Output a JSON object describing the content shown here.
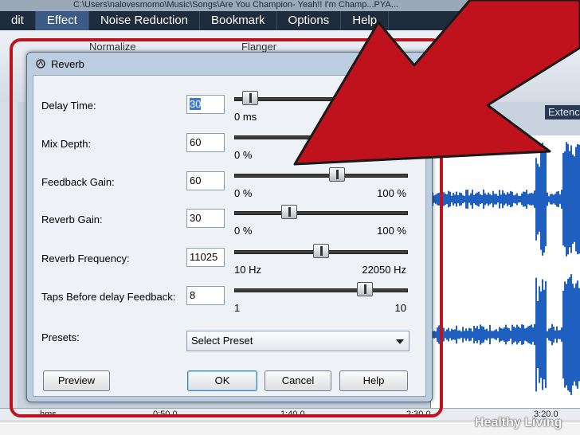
{
  "window": {
    "title": "C:\\Users\\nalovesmomo\\Music\\Songs\\Are You Champion- Yeah!! I'm Champ...PYA..."
  },
  "menubar": {
    "items": [
      "dit",
      "Effect",
      "Noise Reduction",
      "Bookmark",
      "Options",
      "Help"
    ],
    "active": "Effect"
  },
  "toolbar": {
    "normalize_label": "Normalize",
    "flanger_label": "Flanger",
    "extend_tab_label": "Extenc"
  },
  "dialog": {
    "title": "Reverb",
    "params": [
      {
        "label": "Delay Time:",
        "value": "30",
        "min_label": "0 ms",
        "max_label": "",
        "level": 0.05
      },
      {
        "label": "Mix Depth:",
        "value": "60",
        "min_label": "0 %",
        "max_label": "",
        "level": 0.6
      },
      {
        "label": "Feedback Gain:",
        "value": "60",
        "min_label": "0 %",
        "max_label": "100 %",
        "level": 0.6
      },
      {
        "label": "Reverb Gain:",
        "value": "30",
        "min_label": "0 %",
        "max_label": "100 %",
        "level": 0.3
      },
      {
        "label": "Reverb Frequency:",
        "value": "11025",
        "min_label": "10 Hz",
        "max_label": "22050 Hz",
        "level": 0.5
      },
      {
        "label": "Taps Before delay Feedback:",
        "value": "8",
        "min_label": "1",
        "max_label": "10",
        "level": 0.78
      }
    ],
    "presets": {
      "label": "Presets:",
      "selected": "Select Preset"
    },
    "buttons": {
      "preview": "Preview",
      "ok": "OK",
      "cancel": "Cancel",
      "help": "Help"
    }
  },
  "timeline": {
    "ticks": [
      "hms",
      "0:50.0",
      "1:40.0",
      "2:30.0",
      "3:20.0"
    ]
  },
  "watermark": "Healthy Living",
  "colors": {
    "annotation_red": "#c0121c",
    "menubar_bg": "#1f2c3d",
    "waveform_blue": "#1f5fbf",
    "selection_blue": "#3a78d6"
  }
}
